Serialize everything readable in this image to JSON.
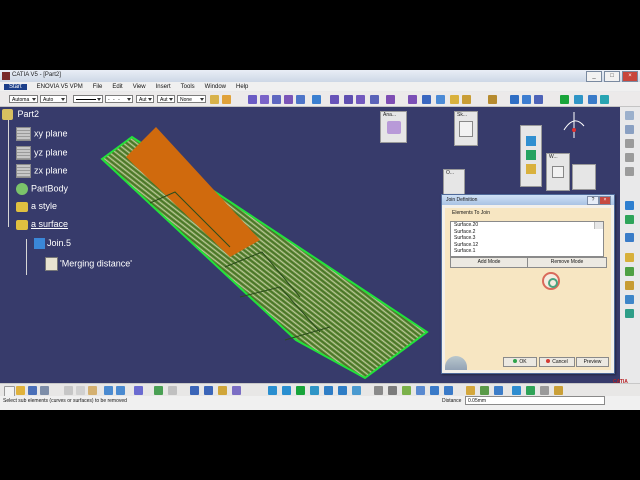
{
  "window": {
    "title": "CATIA V5 - [Part2]"
  },
  "menu": {
    "items": [
      "Start",
      "ENOVIA V5 VPM",
      "File",
      "Edit",
      "View",
      "Insert",
      "Tools",
      "Window",
      "Help"
    ]
  },
  "toolbar": {
    "style_dropdown": "Automa",
    "color_dropdown": "Auto",
    "weight_dropdown": "Aut",
    "layer_dropdown": "Aut",
    "none_dropdown": "None"
  },
  "tree": {
    "root": "Part2",
    "items": [
      {
        "label": "xy plane",
        "icon": "plane-icon"
      },
      {
        "label": "yz plane",
        "icon": "plane-icon"
      },
      {
        "label": "zx plane",
        "icon": "plane-icon"
      },
      {
        "label": "PartBody",
        "icon": "gear-icon"
      },
      {
        "label": "a style",
        "icon": "geoset-icon"
      },
      {
        "label": "a surface",
        "icon": "geoset-icon"
      },
      {
        "label": "Join.5",
        "icon": "join-icon"
      },
      {
        "label": "'Merging distance'",
        "icon": "parameter-icon"
      }
    ]
  },
  "floating_toolbars": {
    "ana": "Ana...",
    "sk": "Sk...",
    "o": "O...",
    "w": "W..."
  },
  "dialog": {
    "title": "Join Definition",
    "group_label": "Elements To Join",
    "elements": [
      "Surface.20",
      "Surface.2",
      "Surface.3",
      "Surface.12",
      "Surface.1"
    ],
    "add_mode": "Add Mode",
    "remove_mode": "Remove Mode",
    "ok": "OK",
    "cancel": "Cancel",
    "preview": "Preview"
  },
  "status": {
    "message": "Select sub elements (curves or surfaces) to be removed",
    "distance_label": "Distance",
    "distance_value": "0.05mm"
  },
  "brand": {
    "logo_text": "CATIA"
  },
  "colors": {
    "viewport_bg": "#373b6b",
    "surface_outline": "#22e23a",
    "highlight_surface": "#d06a0d",
    "dialog_bg": "#f7e6c2"
  }
}
